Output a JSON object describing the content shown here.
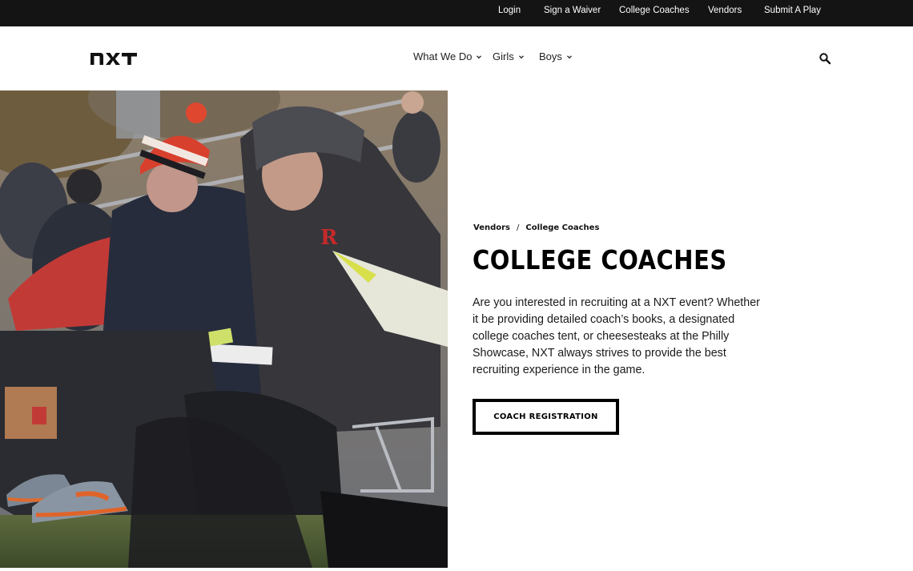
{
  "utility_nav": {
    "items": [
      "Login",
      "Sign a Waiver",
      "College Coaches",
      "Vendors",
      "Submit A Play"
    ]
  },
  "header": {
    "logo_text": "nxt",
    "nav": [
      "What We Do",
      "Girls",
      "Boys"
    ],
    "search_icon": "search-icon"
  },
  "breadcrumb": {
    "items": [
      "Vendors",
      "College Coaches"
    ],
    "separator": "/"
  },
  "main": {
    "title": "COLLEGE COACHES",
    "intro": "Are you interested in recruiting at a NXT event? Whether it be providing detailed coach’s books, a designated college coaches tent, or cheesesteaks at the Philly Showcase, NXT always strives to provide the best recruiting experience in the game.",
    "cta_label": "COACH REGISTRATION"
  },
  "colors": {
    "topbar_bg": "#141414",
    "text": "#111111",
    "accent": "#000000"
  }
}
